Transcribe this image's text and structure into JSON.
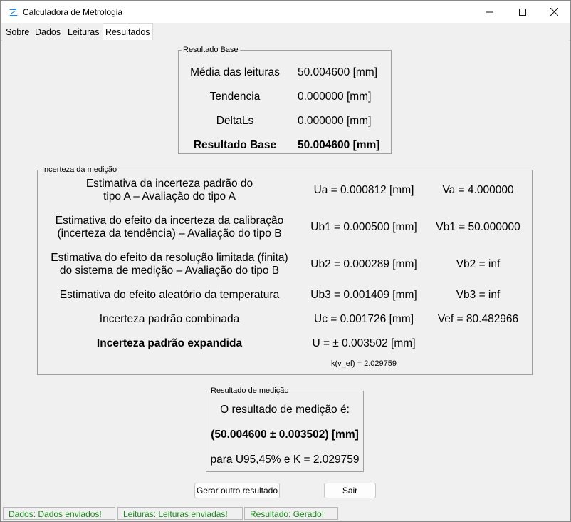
{
  "window": {
    "title": "Calculadora de Metrologia",
    "icon": "calculator-app-icon",
    "controls": {
      "minimize": "─",
      "maximize": "☐",
      "close": "✕"
    }
  },
  "tabs": [
    {
      "label": "Sobre"
    },
    {
      "label": "Dados"
    },
    {
      "label": "Leituras"
    },
    {
      "label": "Resultados",
      "active": true
    }
  ],
  "resultado_base": {
    "legend": "Resultado Base",
    "rows": [
      {
        "label": "Média das leituras",
        "value": "50.004600 [mm]"
      },
      {
        "label": "Tendencia",
        "value": "0.000000 [mm]"
      },
      {
        "label": "DeltaLs",
        "value": "0.000000 [mm]"
      },
      {
        "label": "Resultado Base",
        "value": "50.004600 [mm]"
      }
    ]
  },
  "incerteza": {
    "legend": "Incerteza da medição",
    "rows": [
      {
        "desc1": "Estimativa da incerteza padrão do",
        "desc2": "tipo A – Avaliação do tipo A",
        "u": "Ua = 0.000812 [mm]",
        "v": "Va = 4.000000"
      },
      {
        "desc1": "Estimativa do efeito da incerteza da calibração",
        "desc2": "(incerteza da tendência) – Avaliação do tipo B",
        "u": "Ub1 = 0.000500 [mm]",
        "v": "Vb1 = 50.000000"
      },
      {
        "desc1": "Estimativa do efeito da resolução limitada (finita)",
        "desc2": "do sistema de medição – Avaliação do tipo B",
        "u": "Ub2 = 0.000289 [mm]",
        "v": "Vb2 = inf"
      },
      {
        "desc1": "Estimativa do efeito aleatório da temperatura",
        "u": "Ub3 = 0.001409 [mm]",
        "v": "Vb3 = inf"
      },
      {
        "desc1": "Incerteza padrão combinada",
        "u": "Uc = 0.001726 [mm]",
        "v": "Vef = 80.482966"
      },
      {
        "desc1": "Incerteza padrão expandida",
        "u": "U = ± 0.003502 [mm]",
        "v": ""
      }
    ],
    "k_note": "k(v_ef) = 2.029759"
  },
  "resultado_medicao": {
    "legend": "Resultado de medição",
    "line1": "O resultado de medição é:",
    "line2": "(50.004600 ± 0.003502) [mm]",
    "line3": "para U95,45% e K = 2.029759"
  },
  "buttons": {
    "gerar": "Gerar outro resultado",
    "sair": "Sair"
  },
  "status": [
    {
      "text": "Dados: Dados enviados!"
    },
    {
      "text": "Leituras: Leituras enviadas!"
    },
    {
      "text": "Resultado: Gerado!"
    }
  ],
  "colors": {
    "status_text": "#1a8a1a",
    "app_icon": "#2b7fd6"
  }
}
